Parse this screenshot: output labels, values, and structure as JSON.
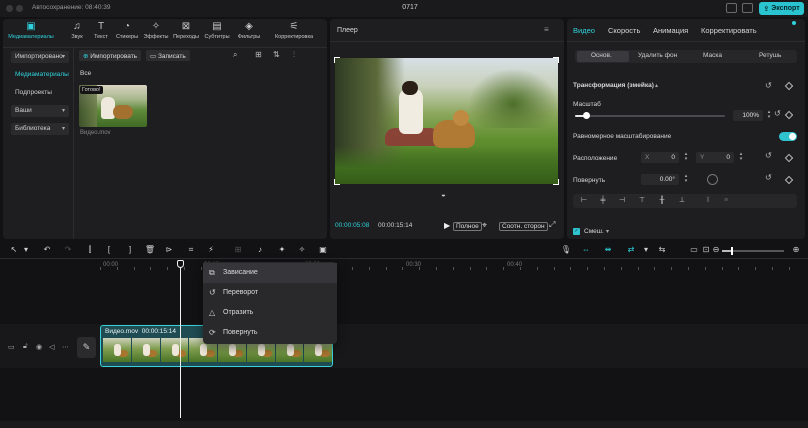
{
  "titlebar": {
    "autosave": "Автосохранение: 08:40:39",
    "title": "0717",
    "export_label": "Экспорт"
  },
  "media_toolbar": {
    "tabs": [
      {
        "label": "Медиаматериалы",
        "icon": "media-icon",
        "glyph": "▣",
        "active": true
      },
      {
        "label": "Звук",
        "icon": "music-note-icon",
        "glyph": "♫",
        "active": false
      },
      {
        "label": "Текст",
        "icon": "text-icon",
        "glyph": "T",
        "active": false
      },
      {
        "label": "Стикеры",
        "icon": "sticker-icon",
        "glyph": "◔",
        "active": false
      },
      {
        "label": "Эффекты",
        "icon": "sparkle-icon",
        "glyph": "✧",
        "active": false
      },
      {
        "label": "Переходы",
        "icon": "transition-icon",
        "glyph": "⊠",
        "active": false
      },
      {
        "label": "Субтитры",
        "icon": "subtitles-icon",
        "glyph": "▤",
        "active": false
      },
      {
        "label": "Фильтры",
        "icon": "filter-icon",
        "glyph": "◈",
        "active": false
      },
      {
        "label": "Корректировка",
        "icon": "adjust-icon",
        "glyph": "⚟",
        "active": false
      }
    ]
  },
  "media_sidebar": {
    "items": [
      {
        "label": "Импортировано",
        "boxed": true,
        "selected": false
      },
      {
        "label": "Медиаматериалы",
        "boxed": false,
        "selected": true
      },
      {
        "label": "Подпроекты",
        "boxed": false,
        "selected": false
      },
      {
        "label": "Ваши",
        "boxed": true,
        "selected": false
      },
      {
        "label": "Библиотека",
        "boxed": true,
        "selected": false
      }
    ]
  },
  "media_panel": {
    "import_label": "Импортировать",
    "record_label": "Записать",
    "section_label": "Все",
    "thumb_badge": "Готово!",
    "thumb_name": "Видео.mov"
  },
  "player": {
    "title": "Плеер",
    "current_time": "00:00:05:08",
    "total_time": "00:00:15:14",
    "quality_label": "Полное",
    "ratio_label": "Соотн. сторон"
  },
  "inspector": {
    "tabs": [
      {
        "label": "Видео",
        "active": true
      },
      {
        "label": "Скорость",
        "active": false
      },
      {
        "label": "Анимация",
        "active": false
      },
      {
        "label": "Корректировать",
        "active": false
      }
    ],
    "subtabs": [
      "Основ.",
      "Удалить фон",
      "Маска",
      "Ретушь"
    ],
    "section_title": "Трансформация (змейка)",
    "scale_label": "Масштаб",
    "scale_value": "100%",
    "scale_fraction": 0.07,
    "uniform_label": "Равномерное масштабирование",
    "position_label": "Расположение",
    "pos_x_label": "X",
    "pos_x": "0",
    "pos_y_label": "Y",
    "pos_y": "0",
    "rotate_label": "Повернуть",
    "rotate_value": "0.00°",
    "blend_label": "Смеш."
  },
  "timeline": {
    "ruler": [
      "00:00",
      "00:10",
      "00:20",
      "00:30",
      "00:40"
    ],
    "clip_name": "Видео.mov",
    "clip_duration": "00:00:15:14",
    "zoom_fraction": 0.15
  },
  "context_menu": {
    "items": [
      {
        "label": "Зависание",
        "icon": "freeze-icon",
        "glyph": "⧉",
        "hover": true
      },
      {
        "label": "Переворот",
        "icon": "reverse-icon",
        "glyph": "↺",
        "hover": false
      },
      {
        "label": "Отразить",
        "icon": "mirror-icon",
        "glyph": "△",
        "hover": false
      },
      {
        "label": "Повернуть",
        "icon": "rotate-icon",
        "glyph": "⟳",
        "hover": false
      }
    ]
  }
}
